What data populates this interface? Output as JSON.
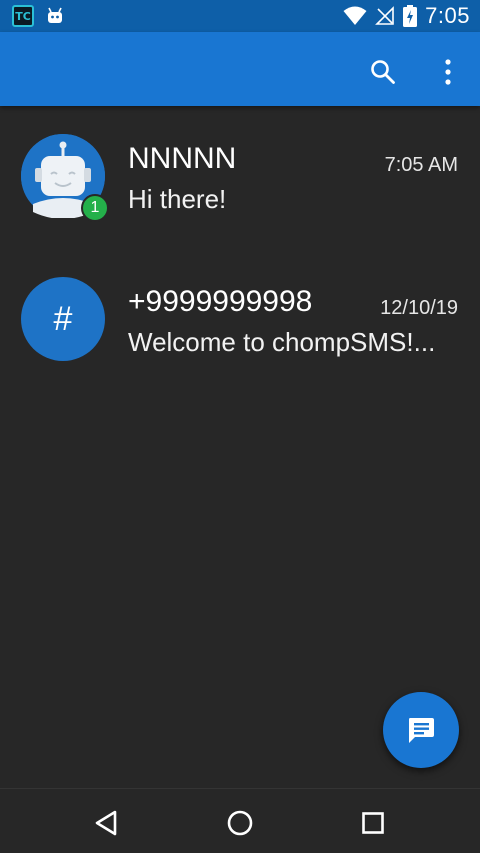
{
  "status_bar": {
    "app_icon_text": "TC",
    "time": "7:05"
  },
  "app_bar": {
    "icons": [
      "search-icon",
      "more-vert-icon"
    ]
  },
  "conversations": [
    {
      "name": "NNNNN",
      "time": "7:05 AM",
      "snippet": "Hi there!",
      "unread": "1",
      "avatar": "robot-avatar"
    },
    {
      "name": "+9999999998",
      "time": "12/10/19",
      "snippet": "Welcome to chompSMS!...",
      "avatar_text": "#"
    }
  ],
  "fab": {
    "icon": "message-icon"
  },
  "nav_bar": {
    "icons": [
      "back-icon",
      "home-icon",
      "recents-icon"
    ]
  },
  "colors": {
    "status_bar": "#0e5fa8",
    "app_bar": "#1976d2",
    "background": "#272727",
    "badge": "#24b04a",
    "avatar": "#1e73c6"
  }
}
